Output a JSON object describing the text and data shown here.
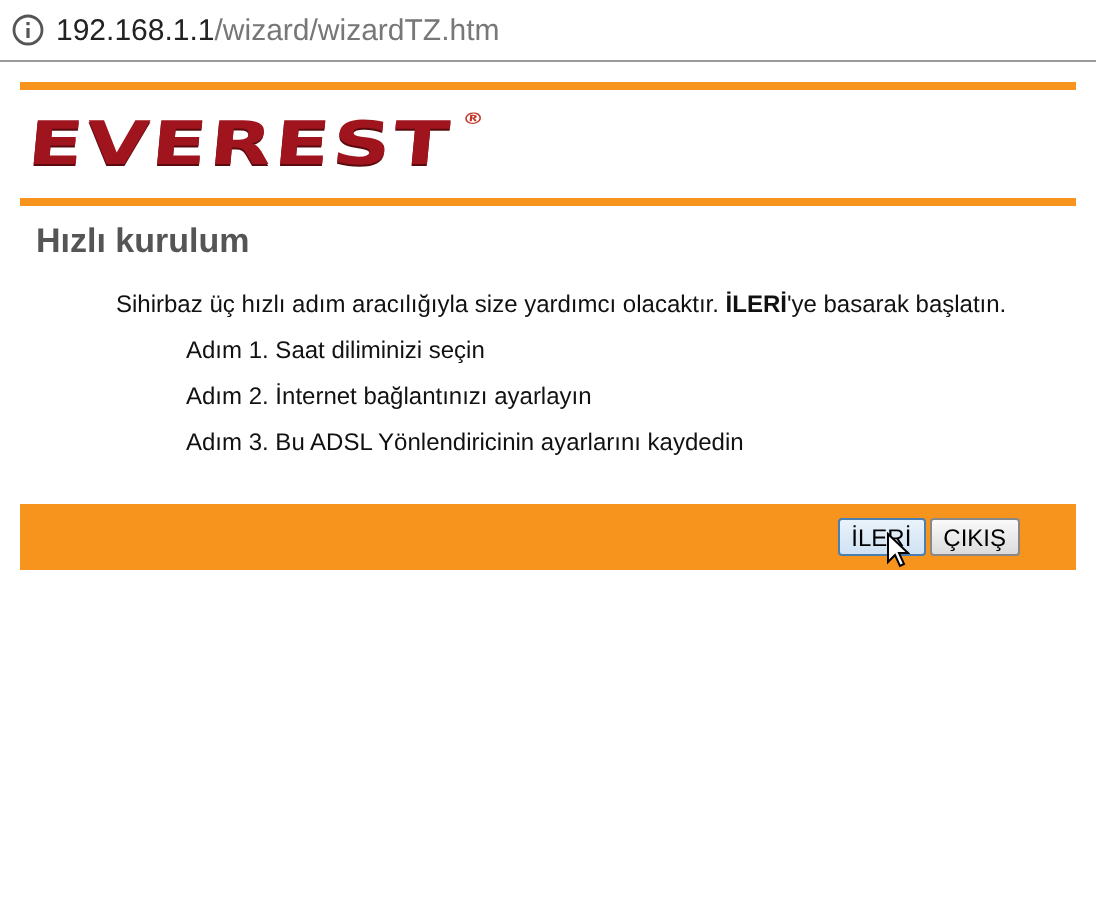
{
  "address_bar": {
    "host": "192.168.1.1",
    "path": "/wizard/wizardTZ.htm"
  },
  "logo": {
    "text": "EVEREST",
    "mark": "®"
  },
  "title": "Hızlı kurulum",
  "intro": "Sihirbaz üç hızlı adım aracılığıyla size yardımcı olacaktır. **İLERİ**'ye basarak başlatın.",
  "steps": [
    "Adım 1. Saat diliminizi seçin",
    "Adım 2. İnternet bağlantınızı ayarlayın",
    "Adım 3. Bu ADSL Yönlendiricinin ayarlarını kaydedin"
  ],
  "buttons": [
    {
      "label": "İLERİ",
      "hovered": true
    },
    {
      "label": "ÇIKIŞ",
      "hovered": false
    }
  ]
}
